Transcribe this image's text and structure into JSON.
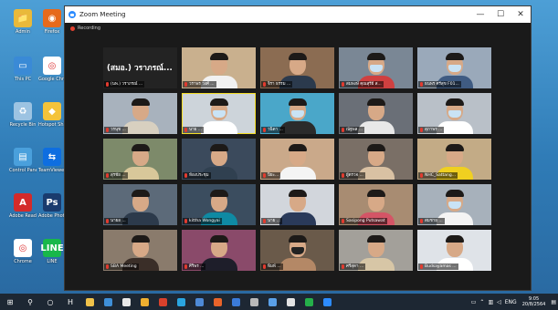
{
  "desktop": {
    "icons": [
      {
        "label": "Admin",
        "color": "#e9b93a",
        "glyph": "📁"
      },
      {
        "label": "Firefox",
        "color": "#e66a1c",
        "glyph": "◉"
      },
      {
        "label": "This PC",
        "color": "#3a8ad6",
        "glyph": "▭"
      },
      {
        "label": "Google Chrome",
        "color": "#ffffff",
        "glyph": "◎"
      },
      {
        "label": "Recycle Bin",
        "color": "#9cc3e2",
        "glyph": "♻"
      },
      {
        "label": "Hotspot Shield",
        "color": "#f4c33a",
        "glyph": "◆"
      },
      {
        "label": "Control Panel",
        "color": "#4aa0dc",
        "glyph": "▤"
      },
      {
        "label": "TeamViewer",
        "color": "#0e6ee0",
        "glyph": "⇆"
      },
      {
        "label": "Adobe Reader",
        "color": "#d42a2a",
        "glyph": "A"
      },
      {
        "label": "Adobe Photoshop",
        "color": "#1a3b6e",
        "glyph": "Ps"
      },
      {
        "label": "Chrome",
        "color": "#ffffff",
        "glyph": "◎"
      },
      {
        "label": "LINE",
        "color": "#18b74a",
        "glyph": "LINE"
      }
    ]
  },
  "zoom": {
    "title": "Zoom Meeting",
    "minimize": "—",
    "maximize": "☐",
    "close": "✕",
    "recording": "Recording",
    "participants": [
      {
        "name": "(นพ.) วราภรณ์ ...",
        "big": "(สมอ.) วราภรณ์...",
        "kind": "text"
      },
      {
        "name": "วราพร วงศ์ ...",
        "bg": "#c9b08e",
        "shirt": "#f1f1f1",
        "mask": "none"
      },
      {
        "name": "จิรา ธรรม ... ",
        "bg": "#8b6c52",
        "shirt": "#2b3a4d",
        "mask": "none"
      },
      {
        "name": "สมพงษ์ คุณสุรีย์ ส...",
        "bg": "#7a8795",
        "shirt": "#cf4040",
        "mask": "light"
      },
      {
        "name": "ธนพร ศรีสุข F01...",
        "bg": "#9aa9ba",
        "shirt": "#3f5b82",
        "mask": "light"
      },
      {
        "name": "วรนุช ...",
        "bg": "#a8b2bd",
        "shirt": "#d8d0c0",
        "mask": "none"
      },
      {
        "name": "นาย ...",
        "bg": "#cdd4da",
        "shirt": "#ffffff",
        "mask": "light",
        "active": true
      },
      {
        "name": "วนิดา ...",
        "bg": "#4aa7c9",
        "shirt": "#2b2b2b",
        "mask": "light"
      },
      {
        "name": "ณัฐพล ...",
        "bg": "#6a6f77",
        "shirt": "#e8e8e8",
        "mask": "none"
      },
      {
        "name": "สุภาพร ...",
        "bg": "#b9c0c8",
        "shirt": "#ffffff",
        "mask": "light"
      },
      {
        "name": "สุรชัย ...",
        "bg": "#7d8a6a",
        "shirt": "#d8c79a",
        "mask": "none"
      },
      {
        "name": "ห้องประชุม",
        "bg": "#3b4a5c",
        "shirt": "#304050",
        "mask": "none"
      },
      {
        "name": "ปิยะ...",
        "bg": "#caa98a",
        "shirt": "#f4f4f4",
        "mask": "none"
      },
      {
        "name": "ผู้ตรวจ ...",
        "bg": "#7a6f66",
        "shirt": "#d9c1a3",
        "mask": "none"
      },
      {
        "name": "NHC_Sattang...",
        "bg": "#c3ab86",
        "shirt": "#f0d020",
        "mask": "none"
      },
      {
        "name": "นายอ ...",
        "bg": "#5c6a79",
        "shirt": "#2c3a4b",
        "mask": "none"
      },
      {
        "name": "kittha Wongyai",
        "bg": "#3b4d5f",
        "shirt": "#0f8aa3",
        "mask": "none"
      },
      {
        "name": "นาย ...",
        "bg": "#d2d6dc",
        "shirt": "#2a3a5a",
        "mask": "none"
      },
      {
        "name": "Sasipong Putsawat",
        "bg": "#a88c72",
        "shirt": "#d45566",
        "mask": "none"
      },
      {
        "name": "สมชาย ...",
        "bg": "#a7b1bb",
        "shirt": "#f4f4f4",
        "mask": "light"
      },
      {
        "name": "SBA Meeting",
        "bg": "#8a7b6c",
        "shirt": "#3a2e28",
        "mask": "none"
      },
      {
        "name": "ศิริพร ...",
        "bg": "#8a4a6a",
        "shirt": "#1e1e2a",
        "mask": "none"
      },
      {
        "name": "พิมพ์ ...",
        "bg": "#6a5a4a",
        "shirt": "#b48866",
        "mask": "dark"
      },
      {
        "name": "ศรีสุดา ...",
        "bg": "#a3a09a",
        "shirt": "#d7c6a6",
        "mask": "none"
      },
      {
        "name": "Budsayamas ...",
        "bg": "#dfe3e8",
        "shirt": "#ffffff",
        "mask": "none"
      }
    ]
  },
  "taskbar": {
    "apps": [
      {
        "name": "start",
        "glyph": "⊞",
        "color": "#ffffff"
      },
      {
        "name": "search",
        "glyph": "⚲",
        "color": "#ffffff"
      },
      {
        "name": "taskview",
        "glyph": "○",
        "color": "#ffffff"
      },
      {
        "name": "files",
        "glyph": "H",
        "color": "#ffffff"
      },
      {
        "name": "app1",
        "glyph": "",
        "color": "#f0c24a"
      },
      {
        "name": "app2",
        "glyph": "",
        "color": "#3f8fd8"
      },
      {
        "name": "app3",
        "glyph": "",
        "color": "#e8e8e8"
      },
      {
        "name": "app4",
        "glyph": "",
        "color": "#f0b030"
      },
      {
        "name": "app5",
        "glyph": "",
        "color": "#d8412c"
      },
      {
        "name": "app6",
        "glyph": "",
        "color": "#2aa5e0"
      },
      {
        "name": "app7",
        "glyph": "",
        "color": "#4e8ad6"
      },
      {
        "name": "app8",
        "glyph": "",
        "color": "#e8642a"
      },
      {
        "name": "app9",
        "glyph": "",
        "color": "#3b7bd9"
      },
      {
        "name": "app10",
        "glyph": "",
        "color": "#b8b8b8"
      },
      {
        "name": "app11",
        "glyph": "",
        "color": "#5aa0e8"
      },
      {
        "name": "app12",
        "glyph": "",
        "color": "#e3e3e3"
      },
      {
        "name": "app13",
        "glyph": "",
        "color": "#25b04a"
      },
      {
        "name": "app14",
        "glyph": "",
        "color": "#2d8cff"
      }
    ],
    "lang": "ENG",
    "time": "9:05",
    "date": "20/8/2564"
  }
}
